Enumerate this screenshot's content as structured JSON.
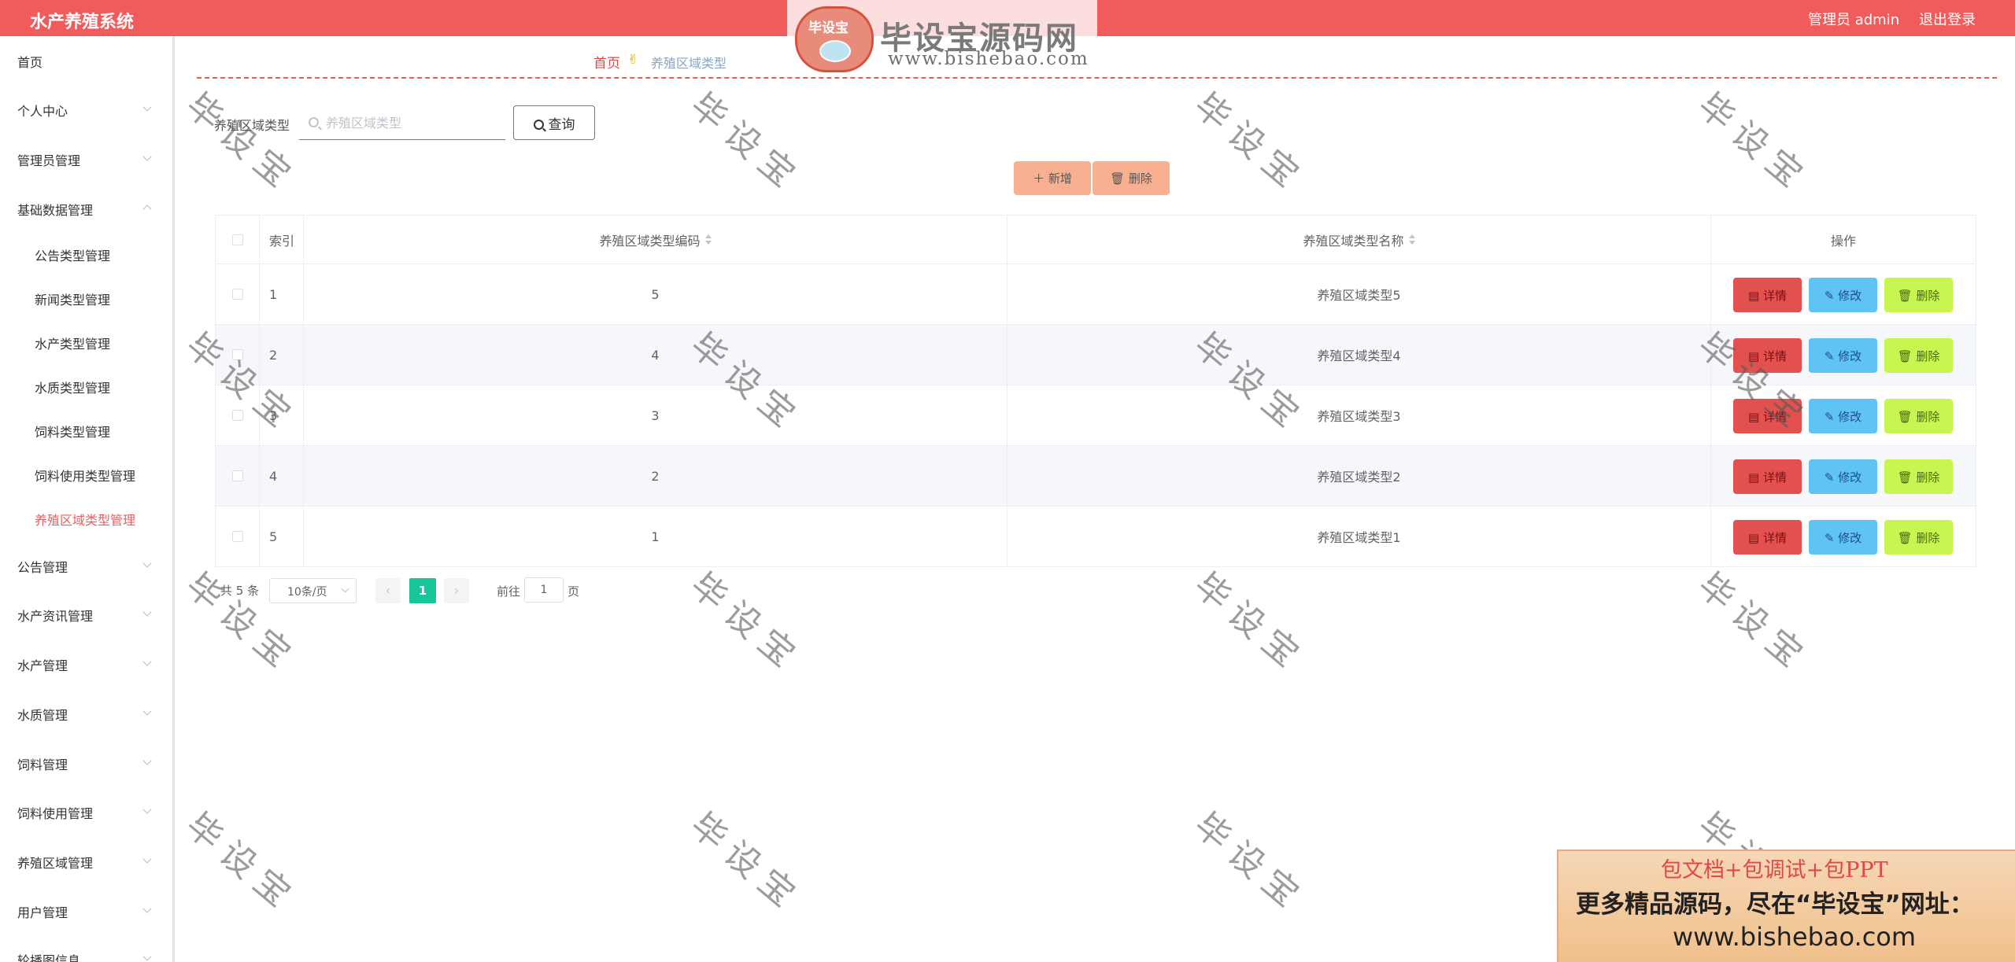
{
  "header": {
    "system_title": "水产养殖系统",
    "admin_label": "管理员 admin",
    "logout_label": "退出登录"
  },
  "brand": {
    "badge_text": "毕设宝",
    "name": "毕设宝源码网",
    "url": "www.bishebao.com"
  },
  "sidebar": {
    "items": [
      {
        "label": "首页",
        "has_chevron": false
      },
      {
        "label": "个人中心",
        "has_chevron": true
      },
      {
        "label": "管理员管理",
        "has_chevron": true
      },
      {
        "label": "基础数据管理",
        "has_chevron": true,
        "expanded": true
      },
      {
        "label": "公告类型管理",
        "sub": true
      },
      {
        "label": "新闻类型管理",
        "sub": true
      },
      {
        "label": "水产类型管理",
        "sub": true
      },
      {
        "label": "水质类型管理",
        "sub": true
      },
      {
        "label": "饲料类型管理",
        "sub": true
      },
      {
        "label": "饲料使用类型管理",
        "sub": true
      },
      {
        "label": "养殖区域类型管理",
        "sub": true,
        "active": true
      },
      {
        "label": "公告管理",
        "has_chevron": true
      },
      {
        "label": "水产资讯管理",
        "has_chevron": true
      },
      {
        "label": "水产管理",
        "has_chevron": true
      },
      {
        "label": "水质管理",
        "has_chevron": true
      },
      {
        "label": "饲料管理",
        "has_chevron": true
      },
      {
        "label": "饲料使用管理",
        "has_chevron": true
      },
      {
        "label": "养殖区域管理",
        "has_chevron": true
      },
      {
        "label": "用户管理",
        "has_chevron": true
      },
      {
        "label": "轮播图信息",
        "has_chevron": true
      }
    ]
  },
  "breadcrumb": {
    "home": "首页",
    "icon": "hand-icon",
    "current": "养殖区域类型"
  },
  "search": {
    "label": "养殖区域类型",
    "placeholder": "养殖区域类型",
    "value": "",
    "button_label": "查询"
  },
  "actions": {
    "add_label": "新增",
    "delete_label": "删除"
  },
  "table": {
    "headers": {
      "index": "索引",
      "code": "养殖区域类型编码",
      "name": "养殖区域类型名称",
      "operation": "操作"
    },
    "row_buttons": {
      "detail": "详情",
      "edit": "修改",
      "delete": "删除"
    },
    "rows": [
      {
        "index": "1",
        "code": "5",
        "name": "养殖区域类型5"
      },
      {
        "index": "2",
        "code": "4",
        "name": "养殖区域类型4"
      },
      {
        "index": "3",
        "code": "3",
        "name": "养殖区域类型3"
      },
      {
        "index": "4",
        "code": "2",
        "name": "养殖区域类型2"
      },
      {
        "index": "5",
        "code": "1",
        "name": "养殖区域类型1"
      }
    ]
  },
  "pagination": {
    "total_text": "共 5 条",
    "page_size": "10条/页",
    "prev_icon": "‹",
    "current_page": "1",
    "next_icon": "›",
    "goto_label": "前往",
    "goto_value": "1",
    "page_unit": "页"
  },
  "watermark": {
    "text": "毕设宝"
  },
  "promo": {
    "line1": "包文档+包调试+包PPT",
    "line2": "更多精品源码，尽在“毕设宝”网址：",
    "line3": "www.bishebao.com"
  },
  "colors": {
    "header_bg": "#f25b5b",
    "accent_red": "#e04848",
    "page_active": "#18c69a",
    "detail_btn": "#e25050",
    "edit_btn": "#5fc3f4",
    "delete_btn": "#c8f550",
    "toolbar_btn": "#f8b091"
  }
}
